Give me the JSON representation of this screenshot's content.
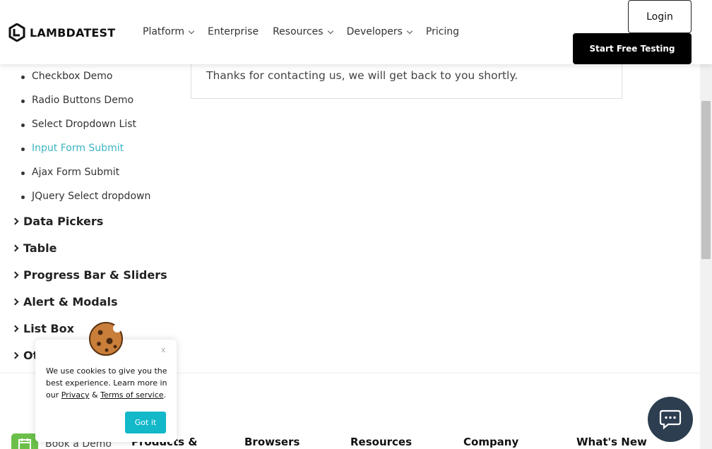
{
  "header": {
    "logo_text": "LAMBDATEST",
    "nav": [
      {
        "label": "Platform",
        "has_dropdown": true
      },
      {
        "label": "Enterprise",
        "has_dropdown": false
      },
      {
        "label": "Resources",
        "has_dropdown": true
      },
      {
        "label": "Developers",
        "has_dropdown": true
      },
      {
        "label": "Pricing",
        "has_dropdown": false
      }
    ],
    "login_label": "Login",
    "start_label": "Start Free Testing"
  },
  "sidebar": {
    "sub_items": [
      {
        "label": "Checkbox Demo",
        "active": false
      },
      {
        "label": "Radio Buttons Demo",
        "active": false
      },
      {
        "label": "Select Dropdown List",
        "active": false
      },
      {
        "label": "Input Form Submit",
        "active": true
      },
      {
        "label": "Ajax Form Submit",
        "active": false
      },
      {
        "label": "JQuery Select dropdown",
        "active": false
      }
    ],
    "categories": [
      {
        "label": "Data Pickers"
      },
      {
        "label": "Table"
      },
      {
        "label": "Progress Bar & Sliders"
      },
      {
        "label": "Alert & Modals"
      },
      {
        "label": "List Box"
      },
      {
        "label": "Ot"
      }
    ]
  },
  "panel": {
    "message": "Thanks for contacting us, we will get back to you shortly."
  },
  "cookie": {
    "close_label": "x",
    "text_before": "We use cookies to give you the best experience. Learn more in our ",
    "privacy_label": "Privacy",
    "amp": " & ",
    "terms_label": "Terms of service",
    "period": ".",
    "button_label": "Got it"
  },
  "footer": {
    "book_demo_label": "Book a Demo",
    "columns": [
      "Products &",
      "Browsers",
      "Resources",
      "Company",
      "What's New"
    ]
  },
  "colors": {
    "active_link": "#3cb4c4",
    "got_it_button": "#13b8c9",
    "chat_button": "#2c3e50",
    "book_demo_icon": "#6cc04a"
  },
  "icons": {
    "chat": "chat-bubble-icon",
    "cookie": "cookie-icon",
    "logo": "lambdatest-logo-icon",
    "calendar": "calendar-icon"
  }
}
